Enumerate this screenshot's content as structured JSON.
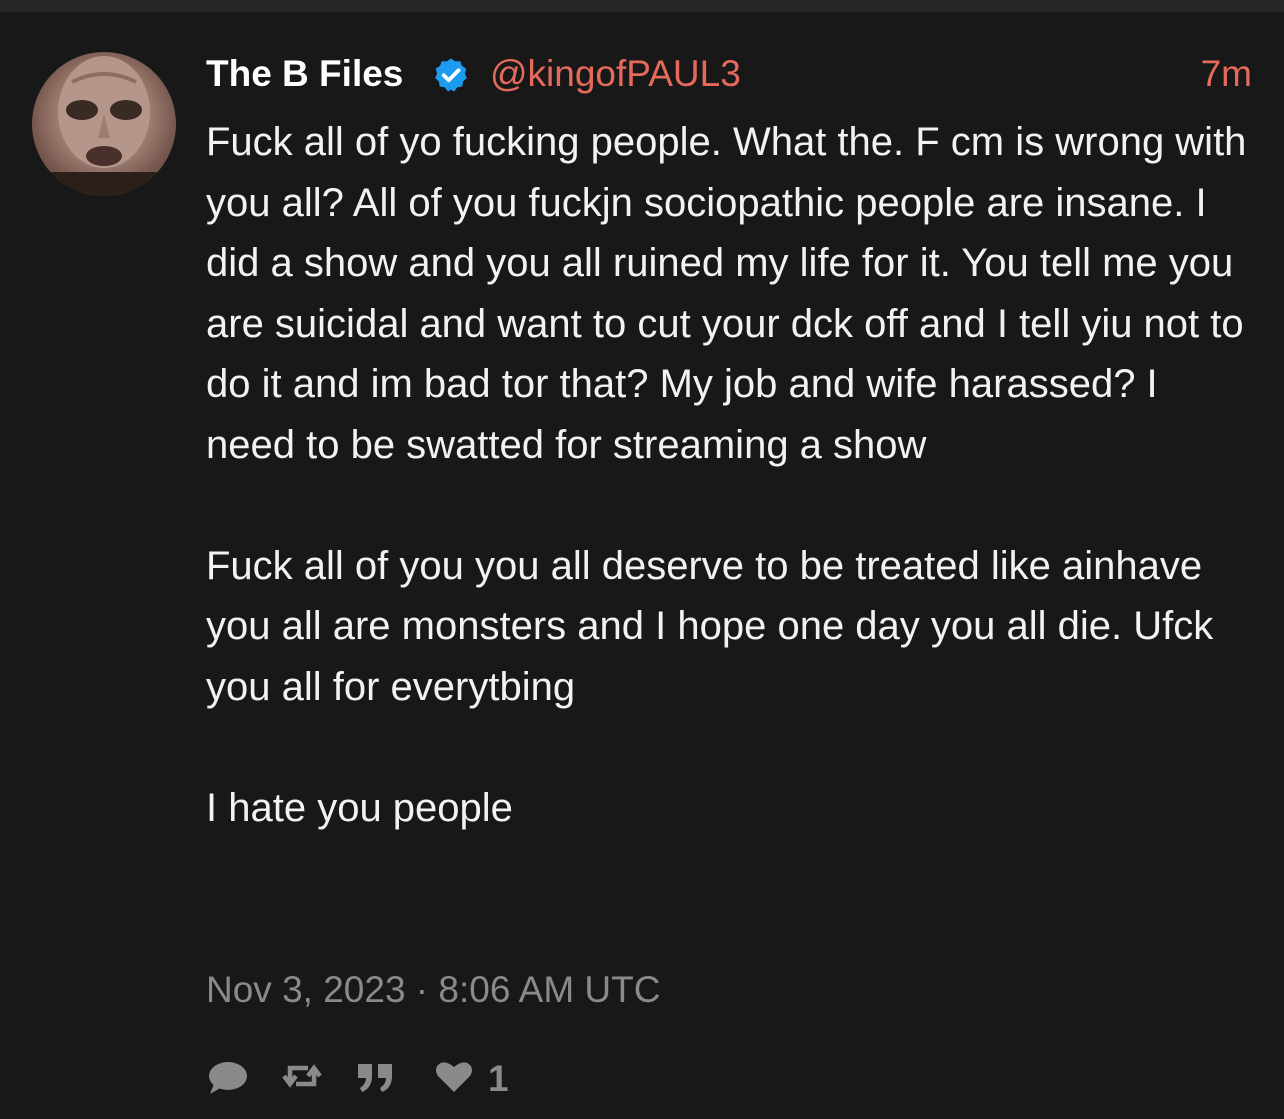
{
  "tweet": {
    "author_name": "The B Files",
    "handle": "@kingofPAUL3",
    "relative_time": "7m",
    "paragraphs": [
      "Fuck all of yo fucking people. What the. F cm is wrong with you all? All of you fuckjn sociopathic people are insane. I did a show and you all ruined my life for it. You tell me you are suicidal and want to cut your dck off and I tell yiu not to do it and im bad tor that? My job and wife harassed? I need to be swatted for streaming a show",
      "Fuck all of you you all deserve to be treated like ainhave you all are monsters and I hope one day you all die. Ufck you all for everytbing",
      "I hate you people"
    ],
    "timestamp": "Nov 3, 2023 · 8:06 AM UTC",
    "like_count": "1"
  },
  "icons": {
    "verified": "verified-badge-icon",
    "reply": "reply-icon",
    "retweet": "retweet-icon",
    "quote": "quote-icon",
    "like": "heart-icon"
  },
  "colors": {
    "background": "#181818",
    "handle": "#e66a5b",
    "verified": "#1d9bf0",
    "muted": "#8a8a8a",
    "text": "#f2f2f2"
  }
}
